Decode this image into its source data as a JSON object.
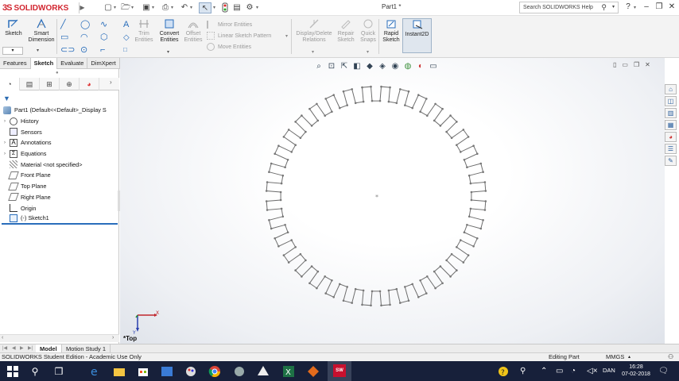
{
  "titlebar": {
    "app_name": "SOLIDWORKS",
    "brand_prefix": "3S",
    "document_title": "Part1 *",
    "search_placeholder": "Search SOLIDWORKS Help",
    "help_label": "?",
    "quick_access_icons": [
      "new-icon",
      "open-icon",
      "save-icon",
      "print-icon",
      "undo-icon",
      "select-icon",
      "rebuild-icon",
      "options-icon"
    ],
    "window_icons": [
      "minimize-icon",
      "restore-icon",
      "close-icon"
    ]
  },
  "command_manager": {
    "sketch_label": "Sketch",
    "smart_dimension_label": "Smart\nDimension",
    "trim_label": "Trim\nEntities",
    "convert_label": "Convert\nEntities",
    "offset_label": "Offset\nEntities",
    "mirror_label": "Mirror Entities",
    "linear_pattern_label": "Linear Sketch Pattern",
    "move_label": "Move Entities",
    "display_delete_label": "Display/Delete\nRelations",
    "repair_label": "Repair\nSketch",
    "quick_snaps_label": "Quick\nSnaps",
    "rapid_sketch_label": "Rapid\nSketch",
    "instant2d_label": "Instant2D"
  },
  "tabs": [
    "Features",
    "Sketch",
    "Evaluate",
    "DimXpert"
  ],
  "active_tab": "Sketch",
  "feature_tree": {
    "root_label": "Part1  (Default<<Default>_Display S",
    "items": [
      {
        "label": "History",
        "expandable": true,
        "icon": "history-icon"
      },
      {
        "label": "Sensors",
        "expandable": false,
        "icon": "sensors-icon"
      },
      {
        "label": "Annotations",
        "expandable": true,
        "icon": "annotations-icon"
      },
      {
        "label": "Equations",
        "expandable": true,
        "icon": "equations-icon"
      },
      {
        "label": "Material <not specified>",
        "expandable": false,
        "icon": "material-icon"
      },
      {
        "label": "Front Plane",
        "expandable": false,
        "icon": "plane-icon"
      },
      {
        "label": "Top Plane",
        "expandable": false,
        "icon": "plane-icon"
      },
      {
        "label": "Right Plane",
        "expandable": false,
        "icon": "plane-icon"
      },
      {
        "label": "Origin",
        "expandable": false,
        "icon": "origin-icon"
      },
      {
        "label": "(-) Sketch1",
        "expandable": false,
        "icon": "sketch-icon"
      }
    ]
  },
  "viewport": {
    "view_label": "*Top",
    "triad_x": "X",
    "triad_y": "Y",
    "sketch_teeth": 36
  },
  "bottom_tabs": [
    "Model",
    "Motion Study 1"
  ],
  "active_bottom_tab": "Model",
  "status_bar": {
    "left_text": "SOLIDWORKS Student Edition - Academic Use Only",
    "mode": "Editing Part",
    "units": "MMGS"
  },
  "taskbar": {
    "time": "16:28",
    "date": "07-02-2018",
    "language": "DAN",
    "apps": [
      "start-icon",
      "search-icon",
      "task-view-icon",
      "edge-icon",
      "file-explorer-icon",
      "store-icon",
      "photos-icon",
      "paint-icon",
      "chrome-icon",
      "app-icon",
      "inkscape-icon",
      "excel-icon",
      "app-icon",
      "solidworks-icon"
    ]
  }
}
